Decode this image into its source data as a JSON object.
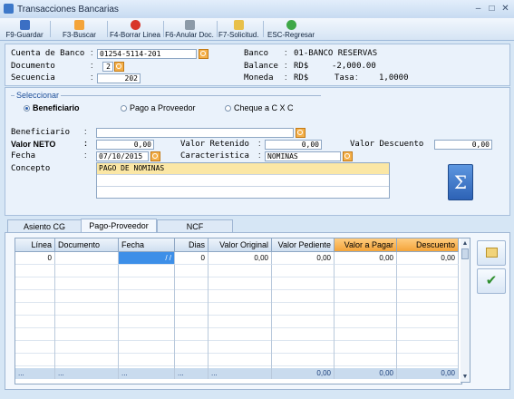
{
  "window": {
    "title": "Transacciones Bancarias",
    "minimize_icon": "minimize-icon",
    "maximize_icon": "maximize-icon",
    "close_icon": "close-icon"
  },
  "toolbar": [
    {
      "label": "F9-Guardar",
      "icon": "save-icon",
      "color": "#3b6fc4"
    },
    {
      "label": "F3-Buscar",
      "icon": "search-icon",
      "color": "#f4a43a"
    },
    {
      "label": "F4-Borrar Linea",
      "icon": "delete-icon",
      "color": "#d8352a"
    },
    {
      "label": "F6-Anular Doc.",
      "icon": "trash-icon",
      "color": "#8c9aa8"
    },
    {
      "label": "F7-Solicitud.",
      "icon": "edit-icon",
      "color": "#e8c04a"
    },
    {
      "label": "ESC-Regresar",
      "icon": "back-icon",
      "color": "#3fa848"
    }
  ],
  "header": {
    "cuenta_label": "Cuenta de Banco",
    "cuenta_value": "01254-5114-201",
    "documento_label": "Documento",
    "documento_value": "2",
    "secuencia_label": "Secuencia",
    "secuencia_value": "202",
    "banco_label": "Banco",
    "banco_value": "01-BANCO RESERVAS",
    "balance_label": "Balance",
    "balance_currency": "RD$",
    "balance_value": "-2,000.00",
    "moneda_label": "Moneda",
    "moneda_value": "RD$",
    "tasa_label": "Tasa",
    "tasa_value": "1,0000"
  },
  "seleccionar": {
    "title": "Seleccionar",
    "options": [
      {
        "label": "Beneficiario",
        "selected": true
      },
      {
        "label": "Pago a Proveedor",
        "selected": false
      },
      {
        "label": "Cheque a C X C",
        "selected": false
      }
    ]
  },
  "form": {
    "beneficiario_label": "Beneficiario",
    "beneficiario_value": "",
    "valor_neto_label": "Valor NETO",
    "valor_neto_value": "0,00",
    "valor_retenido_label": "Valor Retenido",
    "valor_retenido_value": "0,00",
    "valor_descuento_label": "Valor Descuento",
    "valor_descuento_value": "0,00",
    "fecha_label": "Fecha",
    "fecha_value": "07/10/2015",
    "caracteristica_label": "Caracteristica",
    "caracteristica_value": "NOMINAS",
    "concepto_label": "Concepto",
    "concepto_value": "PAGO DE NOMINAS",
    "sum_button": "Σ",
    "sep": ":"
  },
  "tabs": [
    "Asiento CG",
    "Pago-Proveedor",
    "NCF"
  ],
  "grid": {
    "columns": [
      "Línea",
      "Documento",
      "Fecha",
      "Dias",
      "Valor Original",
      "Valor Pediente",
      "Valor a Pagar",
      "Descuento"
    ],
    "row": [
      "0",
      "",
      "/ /",
      "0",
      "0,00",
      "0,00",
      "0,00",
      "0,00"
    ],
    "footer": [
      "...",
      "...",
      "...",
      "...",
      "...",
      "0,00",
      "0,00",
      "0,00"
    ],
    "accent": "#f4a43a"
  },
  "side_buttons": {
    "edit_icon": "edit-note-icon",
    "confirm_icon": "checkmark-icon"
  }
}
